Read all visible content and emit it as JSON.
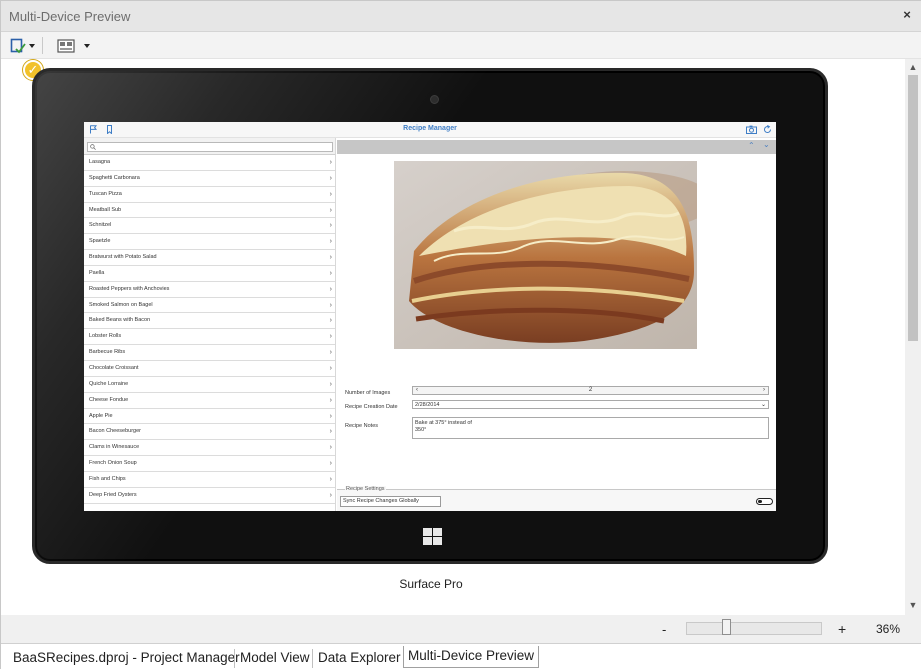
{
  "window": {
    "title": "Multi-Device Preview",
    "close_glyph": "×"
  },
  "toolbar": {
    "select_device_icon": "device-check-icon",
    "layout_icon": "view-layout-icon"
  },
  "device": {
    "name": "Surface Pro"
  },
  "app": {
    "title": "Recipe Manager",
    "header_left_icons": [
      "flag-icon",
      "bookmark-icon"
    ],
    "header_right_icons": [
      "camera-icon",
      "refresh-icon"
    ],
    "search": {
      "placeholder": ""
    },
    "recipes": [
      "Lasagna",
      "Spaghetti Carbonara",
      "Tuscan Pizza",
      "Meatball Sub",
      "Schnitzel",
      "Spaetzle",
      "Bratwurst with Potato Salad",
      "Paella",
      "Roasted Peppers with Anchovies",
      "Smoked Salmon on Bagel",
      "Baked Beans with Bacon",
      "Lobster Rolls",
      "Barbecue Ribs",
      "Chocolate Croissant",
      "Quiche Lorraine",
      "Cheese Fondue",
      "Apple Pie",
      "Bacon Cheeseburger",
      "Clams in Winesauce",
      "French Onion Soup",
      "Fish and Chips",
      "Deep Fried Oysters"
    ],
    "detail": {
      "number_of_images_label": "Number of Images",
      "number_of_images_value": "2",
      "creation_date_label": "Recipe Creation Date",
      "creation_date_value": "2/28/2014",
      "notes_label": "Recipe Notes",
      "notes_value": "Bake at 375° instead of\n350°"
    },
    "settings": {
      "group_label": "Recipe Settings",
      "sync_label": "Sync Recipe Changes Globally",
      "sync_enabled": false
    }
  },
  "zoom": {
    "minus": "-",
    "plus": "+",
    "value": "36%",
    "level_percent": 36
  },
  "tabs": [
    {
      "label": "BaaSRecipes.dproj - Project Manager",
      "active": false
    },
    {
      "label": "Model View",
      "active": false
    },
    {
      "label": "Data Explorer",
      "active": false
    },
    {
      "label": "Multi-Device Preview",
      "active": true
    }
  ],
  "colors": {
    "accent": "#3f7ec6",
    "device_bezel": "#101010",
    "check_badge": "#f1c12a"
  }
}
